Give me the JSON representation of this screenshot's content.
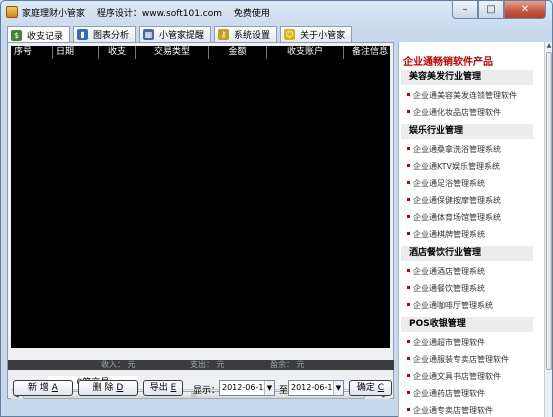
{
  "window": {
    "app_name": "家庭理财小管家",
    "designer": "程序设计：www.soft101.com",
    "license": "免费使用",
    "minimize": "–",
    "maximize": "□",
    "close": "✕"
  },
  "tabs": [
    {
      "label": "收支记录",
      "icon": "money-bag-icon",
      "color": "#3a8a2a",
      "glyph": "$"
    },
    {
      "label": "图表分析",
      "icon": "chart-icon",
      "color": "#2d6cc0",
      "glyph": "▮"
    },
    {
      "label": "小管家提醒",
      "icon": "calendar-icon",
      "color": "#4a6a9a",
      "glyph": "▦"
    },
    {
      "label": "系统设置",
      "icon": "key-icon",
      "color": "#c8a020",
      "glyph": "⚷"
    },
    {
      "label": "关于小管家",
      "icon": "smiley-icon",
      "color": "#e2b000",
      "glyph": "☺"
    }
  ],
  "grid": {
    "columns": [
      "序号",
      "日期",
      "收支",
      "交易类型",
      "金额",
      "收支账户",
      "备注信息"
    ]
  },
  "total_label": "0笔交易",
  "summary": {
    "income": "收入：  元",
    "expense": "支出：  元",
    "balance": "盈余：  元"
  },
  "controls": {
    "add": {
      "label": "新 增",
      "key": "A"
    },
    "delete": {
      "label": "删 除",
      "key": "D"
    },
    "export": {
      "label": "导出",
      "key": "E"
    },
    "display_label": "显示：",
    "date_from": "2012-06-12",
    "to_label": "至",
    "date_to": "2012-06-12",
    "confirm": {
      "label": "确定",
      "key": "C"
    }
  },
  "ad": {
    "title": "企业通畅销软件产品",
    "sections": [
      {
        "name": "美容美发行业管理",
        "items": [
          "企业通美容美发连锁管理软件",
          "企业通化妆品店管理软件"
        ]
      },
      {
        "name": "娱乐行业管理",
        "items": [
          "企业通桑拿洗浴管理系统",
          "企业通KTV娱乐管理系统",
          "企业通足浴管理系统",
          "企业通保健按摩管理系统",
          "企业通体育场馆管理系统",
          "企业通棋牌管理系统"
        ]
      },
      {
        "name": "酒店餐饮行业管理",
        "items": [
          "企业通酒店管理系统",
          "企业通餐饮管理系统",
          "企业通咖啡厅管理系统"
        ]
      },
      {
        "name": "POS收银管理",
        "items": [
          "企业通超市管理软件",
          "企业通服装专卖店管理软件",
          "企业通文具书店管理软件",
          "企业通药店管理软件",
          "企业通专卖店管理软件"
        ]
      }
    ]
  }
}
